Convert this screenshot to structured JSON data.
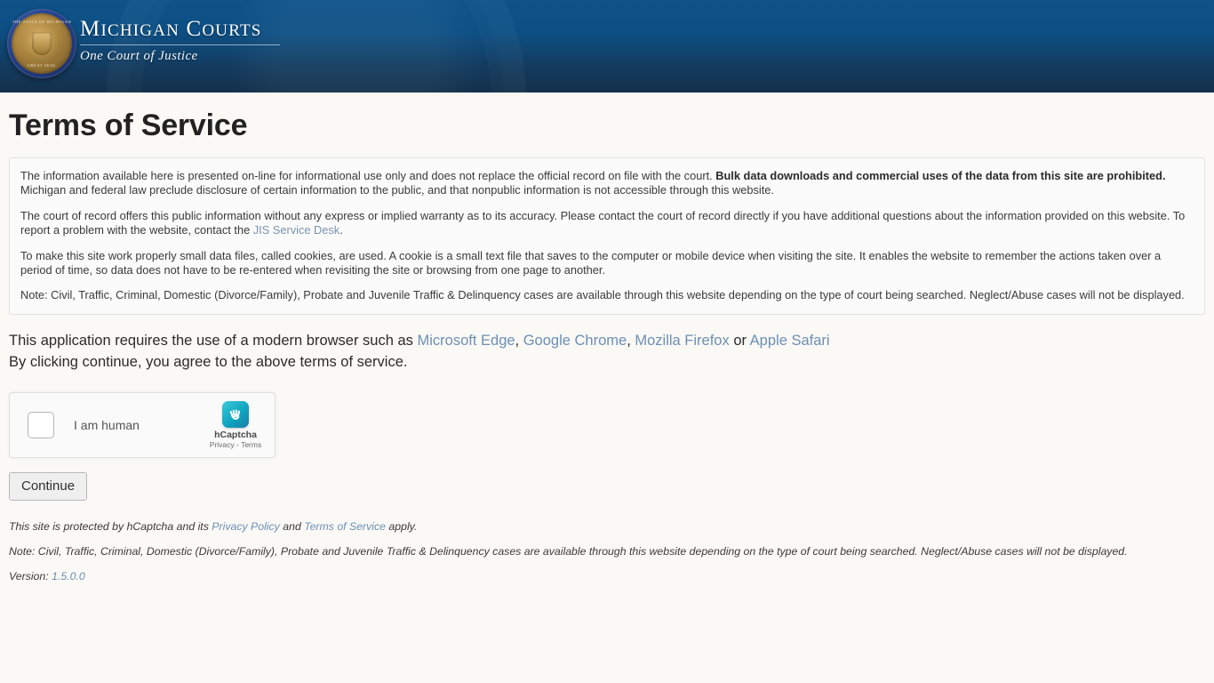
{
  "banner": {
    "seal": {
      "text_top": "THE STATE OF MICHIGAN",
      "text_bottom": "GREAT SEAL"
    },
    "title_main": "ICHIGAN",
    "title_m": "M",
    "title_c": "C",
    "title_courts": "OURTS",
    "subtitle": "One Court of Justice"
  },
  "page": {
    "title": "Terms of Service"
  },
  "tos": {
    "p1_a": "The information available here is presented on-line for informational use only and does not replace the official record on file with the court. ",
    "p1_bold": "Bulk data downloads and commercial uses of the data from this site are prohibited.",
    "p1_b": " Michigan and federal law preclude disclosure of certain information to the public, and that nonpublic information is not accessible through this website.",
    "p2_a": "The court of record offers this public information without any express or implied warranty as to its accuracy. Please contact the court of record directly if you have additional questions about the information provided on this website. To report a problem with the website, contact the ",
    "p2_link": "JIS Service Desk",
    "p2_b": ".",
    "p3": "To make this site work properly small data files, called cookies, are used. A cookie is a small text file that saves to the computer or mobile device when visiting the site. It enables the website to remember the actions taken over a period of time, so data does not have to be re-entered when revisiting the site or browsing from one page to another.",
    "p4": "Note: Civil, Traffic, Criminal, Domestic (Divorce/Family), Probate and Juvenile Traffic & Delinquency cases are available through this website depending on the type of court being searched. Neglect/Abuse cases will not be displayed."
  },
  "browser": {
    "line1_a": "This application requires the use of a modern browser such as ",
    "edge": "Microsoft Edge",
    "sep1": ", ",
    "chrome": "Google Chrome",
    "sep2": ", ",
    "firefox": "Mozilla Firefox",
    "sep3": " or ",
    "safari": "Apple Safari",
    "line2": "By clicking continue, you agree to the above terms of service."
  },
  "captcha": {
    "checkbox_label": "I am human",
    "brand": "hCaptcha",
    "terms": "Privacy - Terms"
  },
  "actions": {
    "continue_label": "Continue"
  },
  "footer": {
    "protect_a": "This site is protected by hCaptcha and its ",
    "privacy_policy": "Privacy Policy",
    "protect_mid": " and ",
    "terms_of_service": "Terms of Service",
    "protect_b": " apply.",
    "note": "Note: Civil, Traffic, Criminal, Domestic (Divorce/Family), Probate and Juvenile Traffic & Delinquency cases are available through this website depending on the type of court being searched. Neglect/Abuse cases will not be displayed.",
    "version_label": "Version: ",
    "version_value": "1.5.0.0"
  },
  "colors": {
    "banner_top": "#0e5389",
    "banner_bottom": "#14304a",
    "page_bg": "#faf9f6",
    "link": "#6d8fb5",
    "captcha_teal": "#0fa5c0"
  }
}
